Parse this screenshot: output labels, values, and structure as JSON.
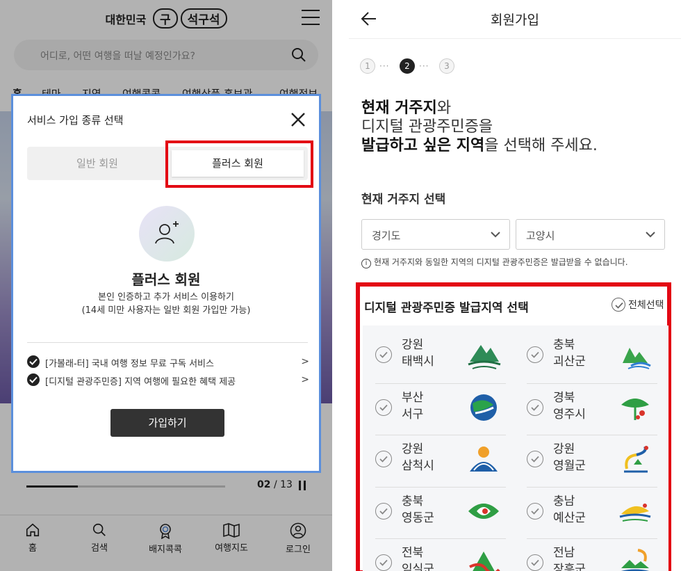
{
  "left": {
    "logo": {
      "left": "대한민국",
      "mid": "구",
      "right": "석구석"
    },
    "search": {
      "placeholder": "어디로, 어떤 여행을 떠날 예정인가요?"
    },
    "tabs": [
      "홈",
      "테마",
      "지역",
      "여행콕콕",
      "여행상품 홍보관",
      "여행정보"
    ],
    "pager": {
      "current": "02",
      "sep": "/",
      "total": "13"
    },
    "slider_progress": 0.26,
    "bottom_nav": [
      {
        "label": "홈",
        "icon": "home-icon"
      },
      {
        "label": "검색",
        "icon": "search-icon"
      },
      {
        "label": "배지콕콕",
        "icon": "badge-icon"
      },
      {
        "label": "여행지도",
        "icon": "map-icon"
      },
      {
        "label": "로그인",
        "icon": "user-icon"
      }
    ],
    "modal": {
      "title": "서비스 가입 종류 선택",
      "tab_general": "일반 회원",
      "tab_plus": "플러스 회원",
      "plus_title": "플러스 회원",
      "desc_line1": "본인 인증하고 추가 서비스 이용하기",
      "desc_line2": "(14세 미만 사용자는 일반 회원 가입만 가능)",
      "benefits": [
        "[가볼래-터] 국내 여행 정보 무료 구독 서비스",
        "[디지털 관광주민증] 지역 여행에 필요한 혜택 제공"
      ],
      "join_button": "가입하기"
    }
  },
  "right": {
    "title": "회원가입",
    "steps": [
      "1",
      "2",
      "3"
    ],
    "active_step": 2,
    "headline": {
      "bold1": "현재 거주지",
      "text1": "와",
      "line2": "디지털 관광주민증을",
      "bold2": "발급하고 싶은 지역",
      "text2": "을 선택해 주세요."
    },
    "residence_label": "현재 거주지 선택",
    "province": "경기도",
    "city": "고양시",
    "notice": "현재 거주지와 동일한 지역의 디지털 관광주민증은 발급받을 수 없습니다.",
    "region_label": "디지털 관광주민증 발급지역 선택",
    "select_all": "전체선택",
    "regions": [
      {
        "prov": "강원",
        "city": "태백시"
      },
      {
        "prov": "충북",
        "city": "괴산군"
      },
      {
        "prov": "부산",
        "city": "서구"
      },
      {
        "prov": "경북",
        "city": "영주시"
      },
      {
        "prov": "강원",
        "city": "삼척시"
      },
      {
        "prov": "강원",
        "city": "영월군"
      },
      {
        "prov": "충북",
        "city": "영동군"
      },
      {
        "prov": "충남",
        "city": "예산군"
      },
      {
        "prov": "전북",
        "city": "임실군"
      },
      {
        "prov": "전남",
        "city": "장흥군"
      }
    ],
    "highlight_color": "#e30613"
  }
}
